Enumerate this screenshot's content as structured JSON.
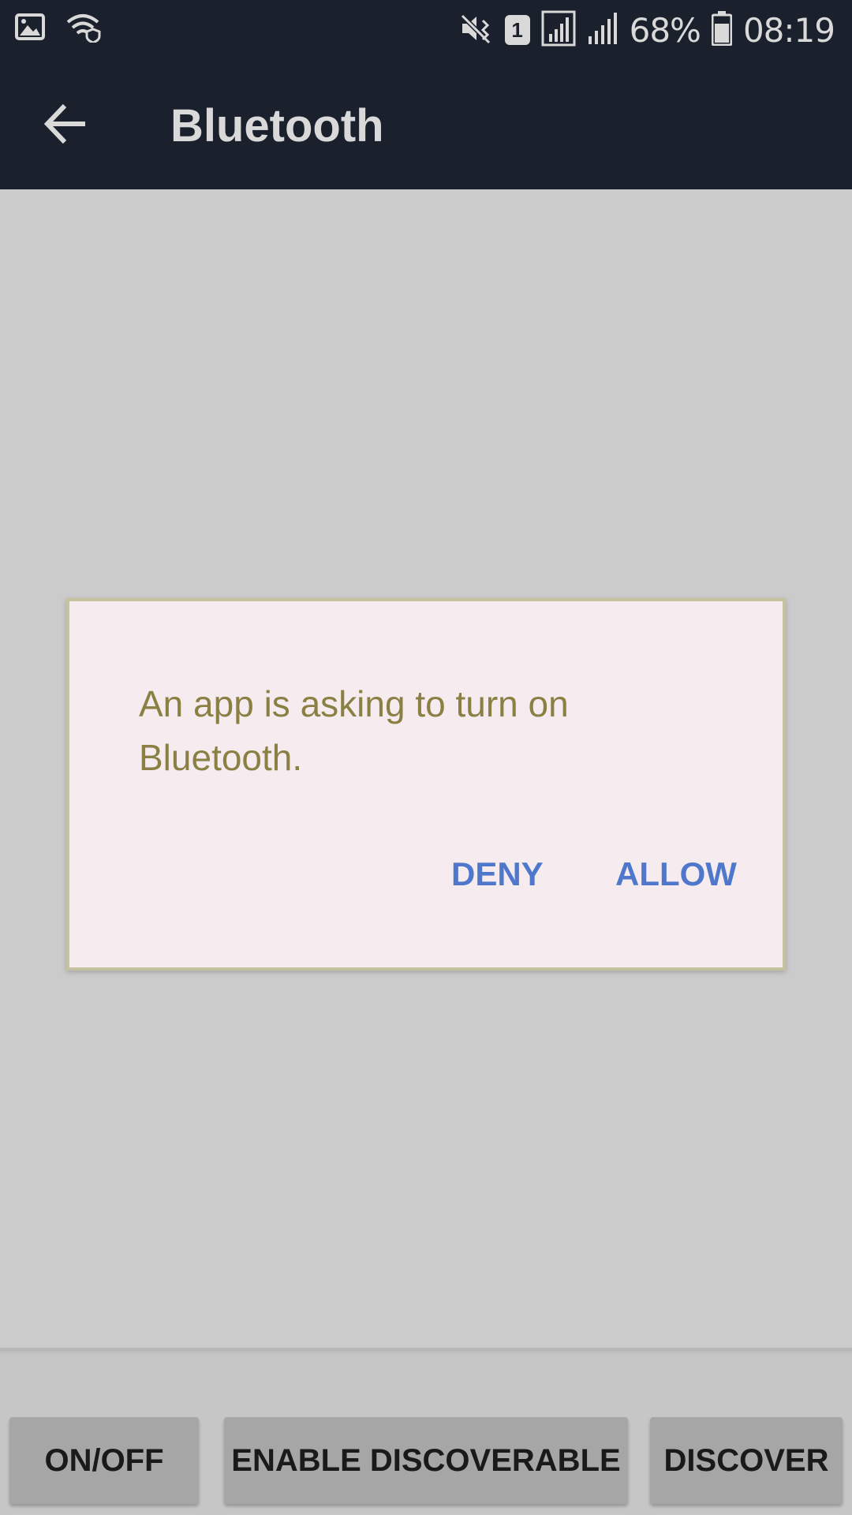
{
  "status_bar": {
    "icons_left": [
      "image-icon",
      "wifi-icon"
    ],
    "icons_right": [
      "mute-icon",
      "sim-icon",
      "signal-icon",
      "signal-icon"
    ],
    "sim_number": "1",
    "battery_percent": "68%",
    "time": "08:19"
  },
  "app_bar": {
    "title": "Bluetooth"
  },
  "dialog": {
    "message": "An app is asking to turn on Bluetooth.",
    "deny_label": "DENY",
    "allow_label": "ALLOW"
  },
  "bottom_buttons": {
    "onoff_label": "ON/OFF",
    "discoverable_label": "ENABLE DISCOVERABLE",
    "discover_label": "DISCOVER"
  },
  "colors": {
    "bar_bg": "#1b202d",
    "dialog_bg": "#f6ecef",
    "dialog_text": "#8b8044",
    "dialog_button": "#4f78cc"
  }
}
